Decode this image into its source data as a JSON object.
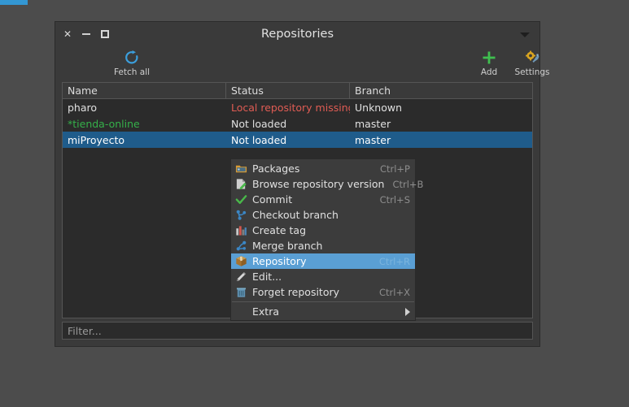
{
  "window": {
    "title": "Repositories",
    "controls": {
      "close": "×",
      "minimize": "−",
      "maximize": "□"
    },
    "menu_arrow_icon": "chevron-down-icon"
  },
  "toolbar": {
    "buttons": [
      {
        "label": "Fetch all",
        "icon": "refresh-icon"
      },
      {
        "label": "Add",
        "icon": "plus-icon"
      },
      {
        "label": "Settings",
        "icon": "gear-wrench-icon"
      }
    ]
  },
  "table": {
    "columns": [
      "Name",
      "Status",
      "Branch"
    ],
    "rows": [
      {
        "name": "pharo",
        "status": "Local repository missing",
        "branch": "Unknown",
        "name_color": "#e0e0e0",
        "status_color": "#e05c54",
        "branch_color": "#e0e0e0",
        "selected": false
      },
      {
        "name": "*tienda-online",
        "status": "Not loaded",
        "branch": "master",
        "name_color": "#35b04a",
        "status_color": "#e0e0e0",
        "branch_color": "#e0e0e0",
        "selected": false
      },
      {
        "name": "miProyecto",
        "status": "Not loaded",
        "branch": "master",
        "name_color": "#ffffff",
        "status_color": "#ffffff",
        "branch_color": "#ffffff",
        "selected": true
      }
    ]
  },
  "filter": {
    "placeholder": "Filter...",
    "value": ""
  },
  "context_menu": {
    "items": [
      {
        "label": "Packages",
        "shortcut": "Ctrl+P",
        "icon": "folder-icon",
        "highlighted": false,
        "submenu": false
      },
      {
        "label": "Browse repository version",
        "shortcut": "Ctrl+B",
        "icon": "document-edit-icon",
        "highlighted": false,
        "submenu": false
      },
      {
        "label": "Commit",
        "shortcut": "Ctrl+S",
        "icon": "checkmark-icon",
        "highlighted": false,
        "submenu": false
      },
      {
        "label": "Checkout branch",
        "shortcut": "",
        "icon": "branch-icon",
        "highlighted": false,
        "submenu": false
      },
      {
        "label": "Create tag",
        "shortcut": "",
        "icon": "bar-chart-icon",
        "highlighted": false,
        "submenu": false
      },
      {
        "label": "Merge branch",
        "shortcut": "",
        "icon": "merge-icon",
        "highlighted": false,
        "submenu": false
      },
      {
        "label": "Repository",
        "shortcut": "Ctrl+R",
        "icon": "box-icon",
        "highlighted": true,
        "submenu": false
      },
      {
        "label": "Edit...",
        "shortcut": "",
        "icon": "pencil-icon",
        "highlighted": false,
        "submenu": false
      },
      {
        "label": "Forget repository",
        "shortcut": "Ctrl+X",
        "icon": "trash-icon",
        "highlighted": false,
        "submenu": false
      },
      {
        "label": "Extra",
        "shortcut": "",
        "icon": "none",
        "highlighted": false,
        "submenu": true
      }
    ]
  },
  "colors": {
    "desktop": "#4c4c4c",
    "window_bg": "#3a3a3a",
    "table_bg": "#2b2b2b",
    "selection": "#1f5c8b",
    "menu_highlight": "#5a9fd4",
    "error_text": "#e05c54",
    "dirty_text": "#35b04a",
    "accent_blue": "#3397d3",
    "add_green": "#3fbf4f"
  }
}
